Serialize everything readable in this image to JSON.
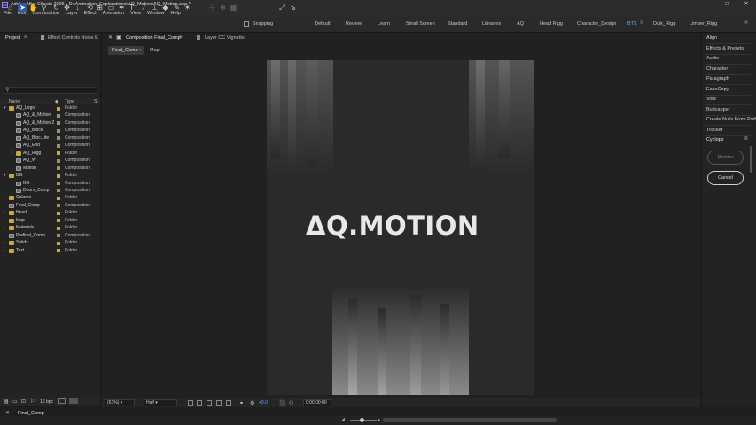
{
  "window": {
    "title": "Adobe After Effects 2025 - D:\\Animation_Explorations\\AQ_Motion\\AQ_Motion.aep *",
    "app_icon": "Ae",
    "controls": [
      "—",
      "□",
      "✕"
    ]
  },
  "menu": [
    "File",
    "Edit",
    "Composition",
    "Layer",
    "Effect",
    "Animation",
    "View",
    "Window",
    "Help"
  ],
  "toolbar": {
    "snapping_label": "Snapping",
    "workspaces": [
      "Default",
      "Review",
      "Learn",
      "Small Screen",
      "Standard",
      "Libraries",
      "AQ",
      "Head Rigg",
      "Character_Design",
      "BTS",
      "Duik_Rigg",
      "Limber_Rigg"
    ],
    "active_workspace": "BTS",
    "accent_color": "#6ea3ff"
  },
  "project_panel": {
    "tab_label": "Project",
    "effect_controls_label": "Effect Controls Noise E",
    "search_placeholder": "",
    "columns": [
      "Name",
      "Type",
      "Si"
    ],
    "items": [
      {
        "name": "AQ_Logo",
        "type": "Folder",
        "kind": "folder",
        "depth": 0,
        "expanded": true,
        "label_color": "#c9a54a"
      },
      {
        "name": "AQ_&_Motion",
        "type": "Composition",
        "kind": "comp",
        "depth": 1,
        "label_color": "#9b9274"
      },
      {
        "name": "AQ_&_Motion 2",
        "type": "Composition",
        "kind": "comp",
        "depth": 1,
        "label_color": "#9b9274"
      },
      {
        "name": "AQ_Block",
        "type": "Composition",
        "kind": "comp",
        "depth": 1,
        "label_color": "#9b9274"
      },
      {
        "name": "AQ_Bloc...ite",
        "type": "Composition",
        "kind": "comp",
        "depth": 1,
        "label_color": "#9b9274"
      },
      {
        "name": "AQ_End",
        "type": "Composition",
        "kind": "comp",
        "depth": 1,
        "label_color": "#9b9274"
      },
      {
        "name": "AQ_Rigg",
        "type": "Folder",
        "kind": "folder",
        "depth": 1,
        "collapsed": true,
        "label_color": "#c9a54a"
      },
      {
        "name": "AQ_W",
        "type": "Composition",
        "kind": "comp",
        "depth": 1,
        "label_color": "#9b9274"
      },
      {
        "name": "Motion",
        "type": "Composition",
        "kind": "comp",
        "depth": 1,
        "label_color": "#9b9274"
      },
      {
        "name": "BG",
        "type": "Folder",
        "kind": "folder",
        "depth": 0,
        "expanded": true,
        "label_color": "#c9a54a"
      },
      {
        "name": "BG",
        "type": "Composition",
        "kind": "comp",
        "depth": 1,
        "label_color": "#9b9274"
      },
      {
        "name": "Doors_Comp",
        "type": "Composition",
        "kind": "comp",
        "depth": 1,
        "label_color": "#9b9274"
      },
      {
        "name": "Column",
        "type": "Folder",
        "kind": "folder",
        "depth": 0,
        "collapsed": true,
        "label_color": "#c9a54a"
      },
      {
        "name": "Final_Comp",
        "type": "Composition",
        "kind": "comp",
        "depth": 0,
        "label_color": "#9b9274"
      },
      {
        "name": "Head",
        "type": "Folder",
        "kind": "folder",
        "depth": 0,
        "collapsed": true,
        "label_color": "#c9a54a"
      },
      {
        "name": "Map",
        "type": "Folder",
        "kind": "folder",
        "depth": 0,
        "collapsed": true,
        "label_color": "#c9a54a"
      },
      {
        "name": "Materials",
        "type": "Folder",
        "kind": "folder",
        "depth": 0,
        "collapsed": true,
        "label_color": "#c9a54a"
      },
      {
        "name": "Prefinal_Comp",
        "type": "Composition",
        "kind": "comp",
        "depth": 0,
        "label_color": "#9b9274"
      },
      {
        "name": "Solids",
        "type": "Folder",
        "kind": "folder",
        "depth": 0,
        "collapsed": true,
        "label_color": "#c9a54a"
      },
      {
        "name": "Text",
        "type": "Folder",
        "kind": "folder",
        "depth": 0,
        "collapsed": true,
        "label_color": "#c9a54a"
      }
    ],
    "bit_depth": "16 bpc"
  },
  "composition_panel": {
    "tab_label": "Composition Final_Comp",
    "layer_tab_label": "Layer CC Vignette",
    "flow_active": "Final_Comp",
    "flow_next": "Map",
    "logo_text": "ΔQ.MOTION",
    "zoom": "(63%)",
    "resolution": "Half",
    "exposure": "+0.0",
    "timecode": "0:00:00:00",
    "exposure_color": "#6ea3ff"
  },
  "right_panel": {
    "items": [
      "Align",
      "Effects & Presets",
      "Audio",
      "Character",
      "Paragraph",
      "EaseCopy",
      "Void",
      "Buttcapper",
      "Create Nulls From Path",
      "Tracker"
    ],
    "cyclops_label": "Cyclops",
    "render_label": "Render",
    "cancel_label": "Cancel"
  },
  "timeline": {
    "tab_label": "Final_Comp"
  }
}
